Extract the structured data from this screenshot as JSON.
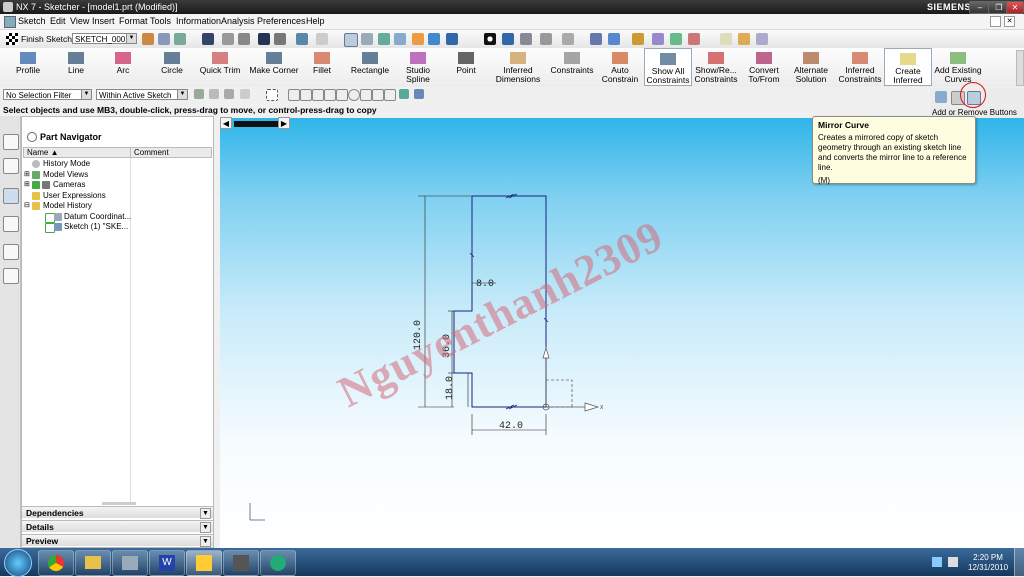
{
  "window": {
    "title": "NX 7 - Sketcher - [model1.prt (Modified)]",
    "brand": "SIEMENS"
  },
  "menu": [
    "Sketch",
    "Edit",
    "View",
    "Insert",
    "Format",
    "Tools",
    "Information",
    "Analysis",
    "Preferences",
    "Help"
  ],
  "toolbar": {
    "finish_label": "Finish Sketch",
    "sketch_name": "SKETCH_000"
  },
  "ribbon": [
    {
      "label": "Profile",
      "icon": "profile-icon"
    },
    {
      "label": "Line",
      "icon": "line-icon"
    },
    {
      "label": "Arc",
      "icon": "arc-icon"
    },
    {
      "label": "Circle",
      "icon": "circle-icon"
    },
    {
      "label": "Quick Trim",
      "icon": "quick-trim-icon"
    },
    {
      "label": "Make Corner",
      "icon": "make-corner-icon"
    },
    {
      "label": "Fillet",
      "icon": "fillet-icon"
    },
    {
      "label": "Rectangle",
      "icon": "rectangle-icon"
    },
    {
      "label": "Studio Spline",
      "icon": "studio-spline-icon"
    },
    {
      "label": "Point",
      "icon": "point-icon"
    },
    {
      "label": "Inferred Dimensions",
      "icon": "inferred-dimensions-icon"
    },
    {
      "label": "Constraints",
      "icon": "constraints-icon"
    },
    {
      "label": "Auto Constrain",
      "icon": "auto-constrain-icon"
    },
    {
      "label": "Show All Constraints",
      "icon": "show-all-constraints-icon"
    },
    {
      "label": "Show/Re... Constraints",
      "icon": "show-remove-constraints-icon"
    },
    {
      "label": "Convert To/From",
      "icon": "convert-icon"
    },
    {
      "label": "Alternate Solution",
      "icon": "alternate-solution-icon"
    },
    {
      "label": "Inferred Constraints",
      "icon": "inferred-constraints-icon"
    },
    {
      "label": "Create Inferred",
      "icon": "create-inferred-icon"
    },
    {
      "label": "Add Existing Curves",
      "icon": "add-existing-curves-icon"
    }
  ],
  "add_remove_label": "Add or Remove Buttons",
  "selection": {
    "filter": "No Selection Filter",
    "scope": "Within Active Sketch Only"
  },
  "cue_line": "Select objects and use MB3, double-click, press-drag to move, or control-press-drag to copy",
  "navigator": {
    "title": "Part Navigator",
    "columns": [
      "Name",
      "Comment"
    ],
    "items": [
      "History Mode",
      "Model Views",
      "Cameras",
      "User Expressions",
      "Model History",
      "Datum Coordinat...",
      "Sketch (1) \"SKE..."
    ],
    "panes": [
      "Dependencies",
      "Details",
      "Preview"
    ]
  },
  "tooltip": {
    "title": "Mirror Curve",
    "body": "Creates a mirrored copy of sketch geometry through an existing sketch line and converts the mirror line to a reference line.",
    "shortcut": "(M)"
  },
  "sketch": {
    "dims": [
      "120.0",
      "36.0",
      "18.0",
      "8.0",
      "42.0"
    ]
  },
  "watermark": "Nguyenthanh2309",
  "clock": {
    "time": "2:20 PM",
    "date": "12/31/2010"
  },
  "colors": {
    "graphics_top": "#2fb5ea",
    "accent_circle": "#d11",
    "watermark": "#d46a7a"
  }
}
